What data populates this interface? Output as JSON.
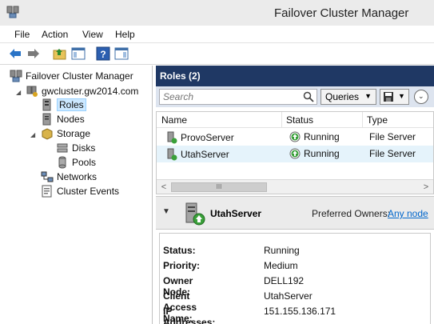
{
  "window": {
    "title": "Failover Cluster Manager"
  },
  "menu": {
    "items": [
      "File",
      "Action",
      "View",
      "Help"
    ]
  },
  "tree": {
    "root": "Failover Cluster Manager",
    "cluster": "gwcluster.gw2014.com",
    "roles": "Roles",
    "nodes": "Nodes",
    "storage": "Storage",
    "disks": "Disks",
    "pools": "Pools",
    "networks": "Networks",
    "events": "Cluster Events"
  },
  "roles_pane": {
    "header": "Roles (2)",
    "search_placeholder": "Search",
    "queries_label": "Queries",
    "columns": [
      "Name",
      "Status",
      "Type"
    ],
    "rows": [
      {
        "name": "ProvoServer",
        "status": "Running",
        "type": "File Server"
      },
      {
        "name": "UtahServer",
        "status": "Running",
        "type": "File Server"
      }
    ]
  },
  "details": {
    "name": "UtahServer",
    "preferred_owners_label": "Preferred Owners:",
    "preferred_owners_link": "Any node",
    "props": [
      {
        "key": "Status:",
        "value": "Running"
      },
      {
        "key": "Priority:",
        "value": "Medium"
      },
      {
        "key": "Owner Node:",
        "value": "DELL192"
      },
      {
        "key": "Client Access Name:",
        "value": "UtahServer"
      },
      {
        "key": "IP Addresses:",
        "value": "151.155.136.171"
      }
    ]
  },
  "colors": {
    "header_bg": "#1f3864",
    "search_bg": "#dde4ef",
    "link": "#0066cc",
    "running_green": "#3aa03a"
  }
}
